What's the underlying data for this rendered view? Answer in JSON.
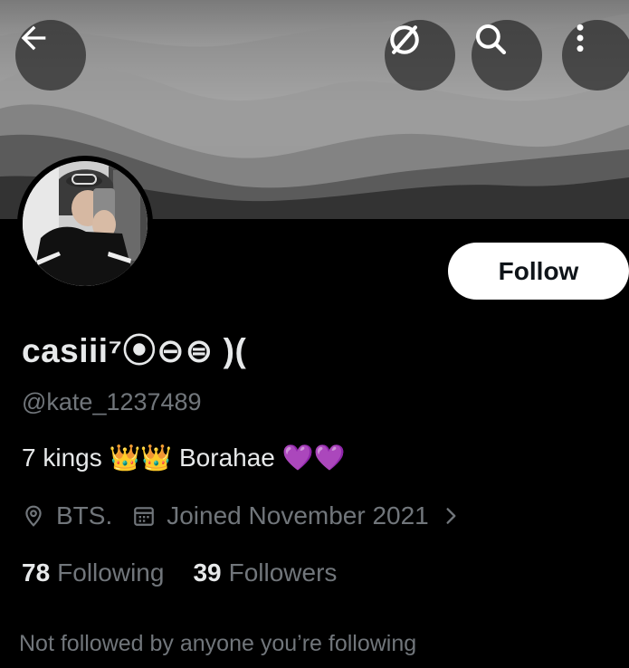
{
  "header": {
    "back_icon": "arrow-left-icon",
    "mute_icon": "muted-circle-icon",
    "search_icon": "search-icon",
    "more_icon": "more-vertical-icon"
  },
  "profile": {
    "display_name": "casiii⁷⦿⊖⊜ )(",
    "handle": "@kate_1237489",
    "bio": "7 kings 👑👑 Borahae 💜💜",
    "location": "BTS.",
    "joined": "Joined November 2021",
    "follow_label": "Follow",
    "following_count": "78",
    "following_label": "Following",
    "followers_count": "39",
    "followers_label": "Followers",
    "mutuals_note": "Not followed by anyone you’re following"
  },
  "colors": {
    "background": "#000000",
    "primary_text": "#e7e9ea",
    "secondary_text": "#71767b",
    "follow_button_bg": "#ffffff",
    "follow_button_text": "#0f1419"
  }
}
